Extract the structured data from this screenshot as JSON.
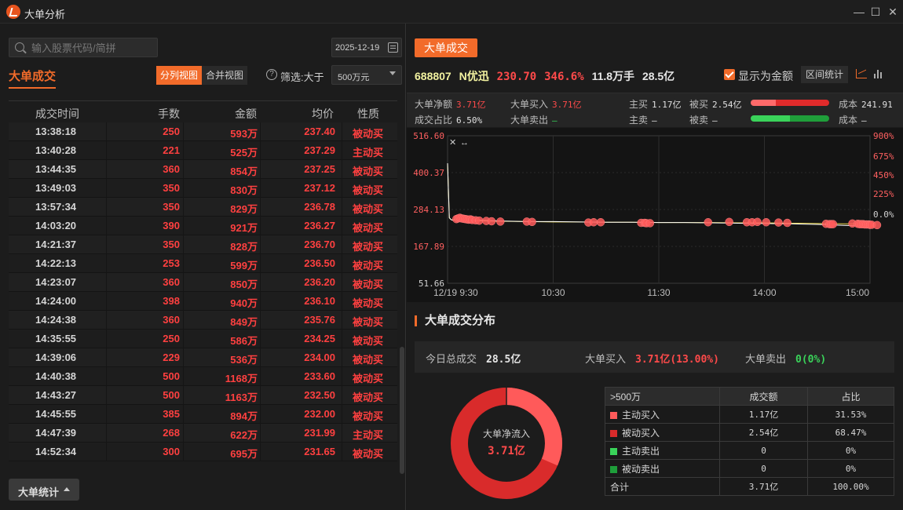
{
  "window": {
    "title": "大单分析"
  },
  "left": {
    "search_placeholder": "输入股票代码/简拼",
    "date": "2025-12-19",
    "section_title": "大单成交",
    "view_split": "分列视图",
    "view_merge": "合并视图",
    "filter_label": "筛选:大于",
    "filter_value": "500万元",
    "columns": [
      "成交时间",
      "手数",
      "金额",
      "均价",
      "性质"
    ],
    "rows": [
      {
        "time": "13:38:18",
        "lots": "250",
        "amount": "593万",
        "price": "237.40",
        "type": "被动买"
      },
      {
        "time": "13:40:28",
        "lots": "221",
        "amount": "525万",
        "price": "237.29",
        "type": "主动买"
      },
      {
        "time": "13:44:35",
        "lots": "360",
        "amount": "854万",
        "price": "237.25",
        "type": "被动买"
      },
      {
        "time": "13:49:03",
        "lots": "350",
        "amount": "830万",
        "price": "237.12",
        "type": "被动买"
      },
      {
        "time": "13:57:34",
        "lots": "350",
        "amount": "829万",
        "price": "236.78",
        "type": "被动买"
      },
      {
        "time": "14:03:20",
        "lots": "390",
        "amount": "921万",
        "price": "236.27",
        "type": "被动买"
      },
      {
        "time": "14:21:37",
        "lots": "350",
        "amount": "828万",
        "price": "236.70",
        "type": "被动买"
      },
      {
        "time": "14:22:13",
        "lots": "253",
        "amount": "599万",
        "price": "236.50",
        "type": "被动买"
      },
      {
        "time": "14:23:07",
        "lots": "360",
        "amount": "850万",
        "price": "236.20",
        "type": "被动买"
      },
      {
        "time": "14:24:00",
        "lots": "398",
        "amount": "940万",
        "price": "236.10",
        "type": "被动买"
      },
      {
        "time": "14:24:38",
        "lots": "360",
        "amount": "849万",
        "price": "235.76",
        "type": "被动买"
      },
      {
        "time": "14:35:55",
        "lots": "250",
        "amount": "586万",
        "price": "234.25",
        "type": "被动买"
      },
      {
        "time": "14:39:06",
        "lots": "229",
        "amount": "536万",
        "price": "234.00",
        "type": "被动买"
      },
      {
        "time": "14:40:38",
        "lots": "500",
        "amount": "1168万",
        "price": "233.60",
        "type": "被动买"
      },
      {
        "time": "14:43:27",
        "lots": "500",
        "amount": "1163万",
        "price": "232.50",
        "type": "被动买"
      },
      {
        "time": "14:45:55",
        "lots": "385",
        "amount": "894万",
        "price": "232.00",
        "type": "被动买"
      },
      {
        "time": "14:47:39",
        "lots": "268",
        "amount": "622万",
        "price": "231.99",
        "type": "主动买"
      },
      {
        "time": "14:52:34",
        "lots": "300",
        "amount": "695万",
        "price": "231.65",
        "type": "被动买"
      }
    ],
    "stats_button": "大单统计"
  },
  "right": {
    "tab": "大单成交",
    "quote": {
      "code": "688807",
      "name": "N优迅",
      "price": "230.70",
      "change_pct": "346.6%",
      "volume": "11.8万手",
      "turnover": "28.5亿"
    },
    "show_amount_label": "显示为金额",
    "interval_button": "区间统计",
    "metrics": {
      "net_label": "大单净额",
      "net_value": "3.71亿",
      "buy_label": "大单买入",
      "buy_value": "3.71亿",
      "ratio_label": "成交占比",
      "ratio_value": "6.50%",
      "sell_label": "大单卖出",
      "sell_value": "—",
      "active_buy_label": "主买",
      "active_buy_value": "1.17亿",
      "passive_buy_label": "被买",
      "passive_buy_value": "2.54亿",
      "active_sell_label": "主卖",
      "active_sell_value": "—",
      "passive_sell_label": "被卖",
      "passive_sell_value": "—",
      "cost_label": "成本",
      "cost_buy_value": "241.91",
      "cost_sell_value": "—",
      "buy_bar_active_fraction": 0.315,
      "sell_bar_active_fraction": 0.5
    },
    "distribution": {
      "title": "大单成交分布",
      "total_label": "今日总成交",
      "total_value": "28.5亿",
      "buy_label": "大单买入",
      "buy_value": "3.71亿(13.00%)",
      "sell_label": "大单卖出",
      "sell_value": "0(0%)",
      "donut_label": "大单净流入",
      "donut_value": "3.71亿",
      "table_header": [
        ">500万",
        "成交额",
        "占比"
      ],
      "table_rows": [
        {
          "label": "主动买入",
          "amount": "1.17亿",
          "pct": "31.53%",
          "color": "#ff5a5a"
        },
        {
          "label": "被动买入",
          "amount": "2.54亿",
          "pct": "68.47%",
          "color": "#d92b2b"
        },
        {
          "label": "主动卖出",
          "amount": "0",
          "pct": "0%",
          "color": "#3ad35a"
        },
        {
          "label": "被动卖出",
          "amount": "0",
          "pct": "0%",
          "color": "#1e9e3a"
        }
      ],
      "total_row": {
        "label": "合计",
        "amount": "3.71亿",
        "pct": "100.00%"
      }
    }
  },
  "chart_data": {
    "type": "line",
    "x_ticks": [
      "12/19 9:30",
      "10:30",
      "11:30",
      "14:00",
      "15:00"
    ],
    "y_left_ticks": [
      "516.60",
      "400.37",
      "284.13",
      "167.89",
      "51.66"
    ],
    "y_right_ticks": [
      "900%",
      "675%",
      "450%",
      "225%",
      "0.0%"
    ],
    "ylim": [
      51.66,
      516.6
    ],
    "price_series_minutes": [
      0,
      1,
      2,
      3,
      5,
      8,
      12,
      20,
      30,
      45,
      60,
      75,
      90,
      105,
      120,
      135,
      150,
      165,
      180,
      195,
      210,
      225,
      240
    ],
    "price_series_values": [
      430,
      258,
      252,
      250,
      254,
      252,
      251,
      250,
      248,
      246,
      246,
      245,
      244,
      244,
      243,
      243,
      242,
      241,
      240,
      239,
      237,
      234,
      232
    ],
    "avg_series_values": [
      430,
      258,
      252,
      251,
      251,
      250,
      249,
      248,
      247,
      246,
      245,
      245,
      244,
      244,
      243,
      243,
      243,
      242,
      242,
      241,
      240,
      239,
      238
    ],
    "big_order_minutes": [
      5,
      6,
      7,
      8,
      9,
      10,
      11,
      12,
      13,
      14,
      16,
      18,
      22,
      25,
      30,
      45,
      48,
      80,
      83,
      87,
      110,
      112,
      113,
      115,
      148,
      160,
      170,
      173,
      176,
      181,
      188,
      193,
      215,
      217,
      218,
      219,
      230,
      233,
      234,
      235,
      236,
      237,
      238,
      239,
      240,
      240,
      241,
      244
    ],
    "big_order_prices": [
      254,
      256,
      258,
      256,
      255,
      254,
      253,
      252,
      253,
      251,
      250,
      249,
      248,
      247,
      246,
      246,
      245,
      243,
      244,
      244,
      242,
      242,
      241,
      241,
      244,
      245,
      244,
      244,
      245,
      244,
      243,
      242,
      239,
      238,
      238,
      238,
      240,
      239,
      238,
      238,
      238,
      237,
      237,
      237,
      236,
      236,
      236,
      235
    ]
  }
}
